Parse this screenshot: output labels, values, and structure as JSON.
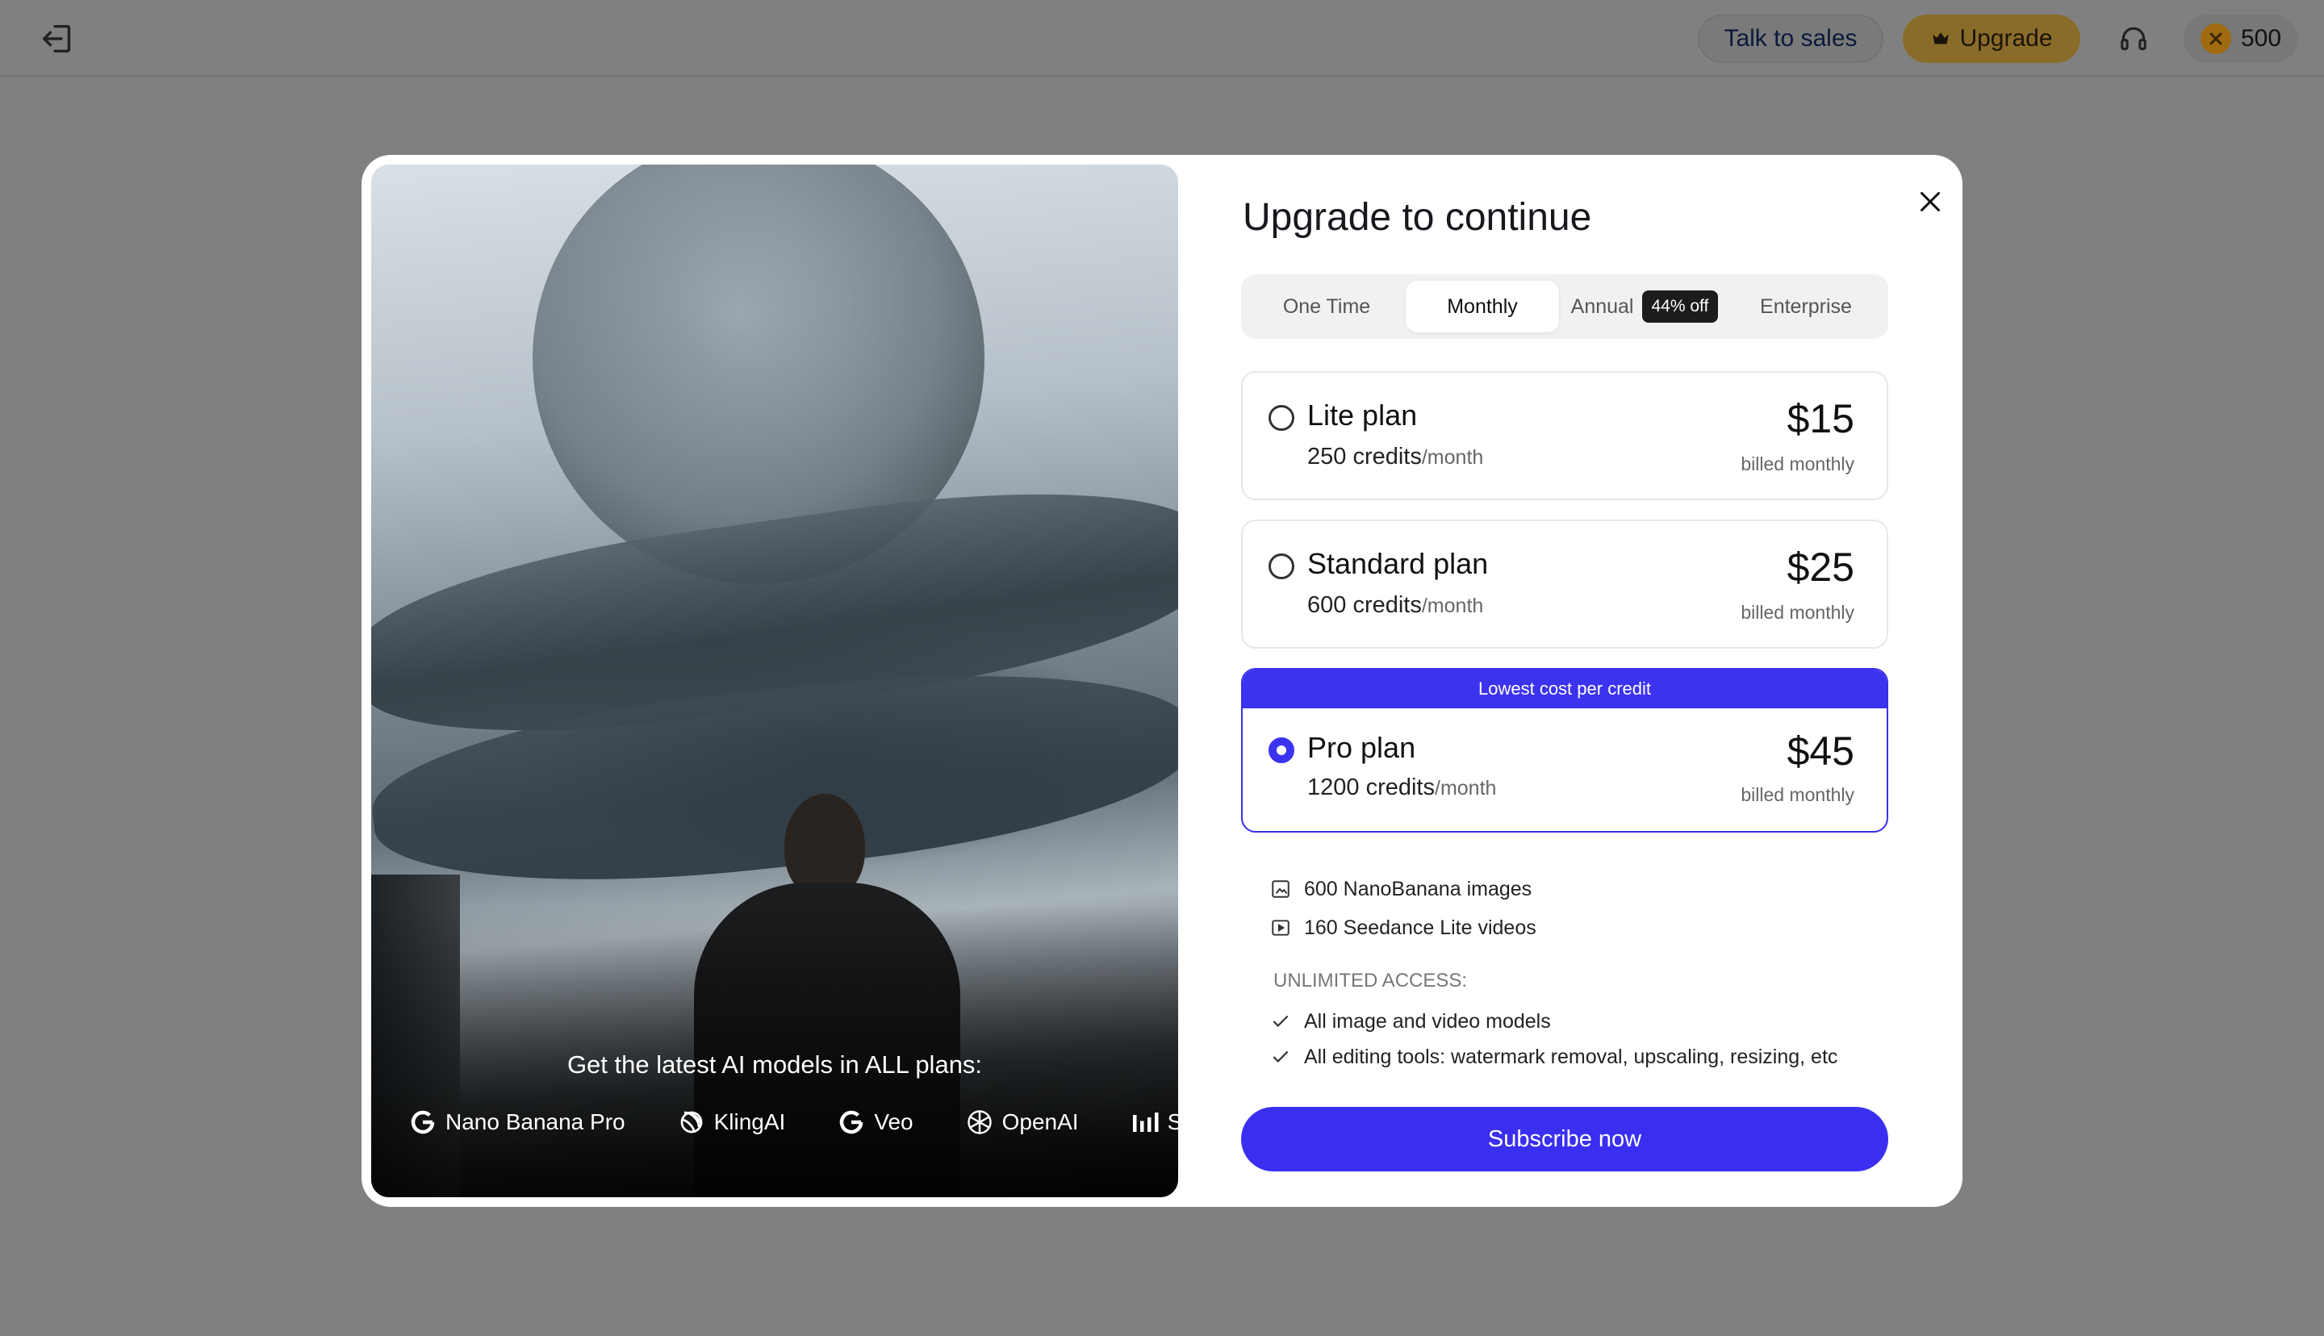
{
  "topbar": {
    "exit_icon": "exit-icon",
    "talk_to_sales": "Talk to sales",
    "upgrade": "Upgrade",
    "upgrade_icon": "crown-icon",
    "support_icon": "headphones-icon",
    "credits": "500"
  },
  "hero": {
    "caption": "Get the latest AI models in ALL plans:",
    "logos": [
      {
        "name": "Nano Banana Pro",
        "icon": "google-g-icon"
      },
      {
        "name": "KlingAI",
        "icon": "kling-icon"
      },
      {
        "name": "Veo",
        "icon": "google-g-icon"
      },
      {
        "name": "OpenAI",
        "icon": "openai-icon"
      },
      {
        "name": "See",
        "icon": "bars-icon"
      }
    ]
  },
  "modal": {
    "title": "Upgrade to continue",
    "tabs": [
      "One Time",
      "Monthly",
      "Annual",
      "Enterprise"
    ],
    "active_tab": "Monthly",
    "annual_badge": "44% off",
    "plans": [
      {
        "name": "Lite plan",
        "credits": "250 credits",
        "unit": "/month",
        "price": "$15",
        "billed": "billed monthly"
      },
      {
        "name": "Standard plan",
        "credits": "600 credits",
        "unit": "/month",
        "price": "$25",
        "billed": "billed monthly"
      },
      {
        "name": "Pro plan",
        "credits": "1200 credits",
        "unit": "/month",
        "price": "$45",
        "billed": "billed monthly",
        "banner": "Lowest cost per credit",
        "selected": true
      }
    ],
    "features": [
      "600 NanoBanana images",
      "160 Seedance Lite videos"
    ],
    "unlimited_heading": "UNLIMITED ACCESS:",
    "unlimited": [
      "All image and video models",
      "All editing tools: watermark removal, upscaling, resizing, etc"
    ],
    "subscribe": "Subscribe now"
  },
  "colors": {
    "accent": "#3a2ff0",
    "overlay": "#808080",
    "upgrade_button": "#8a6c2a"
  }
}
